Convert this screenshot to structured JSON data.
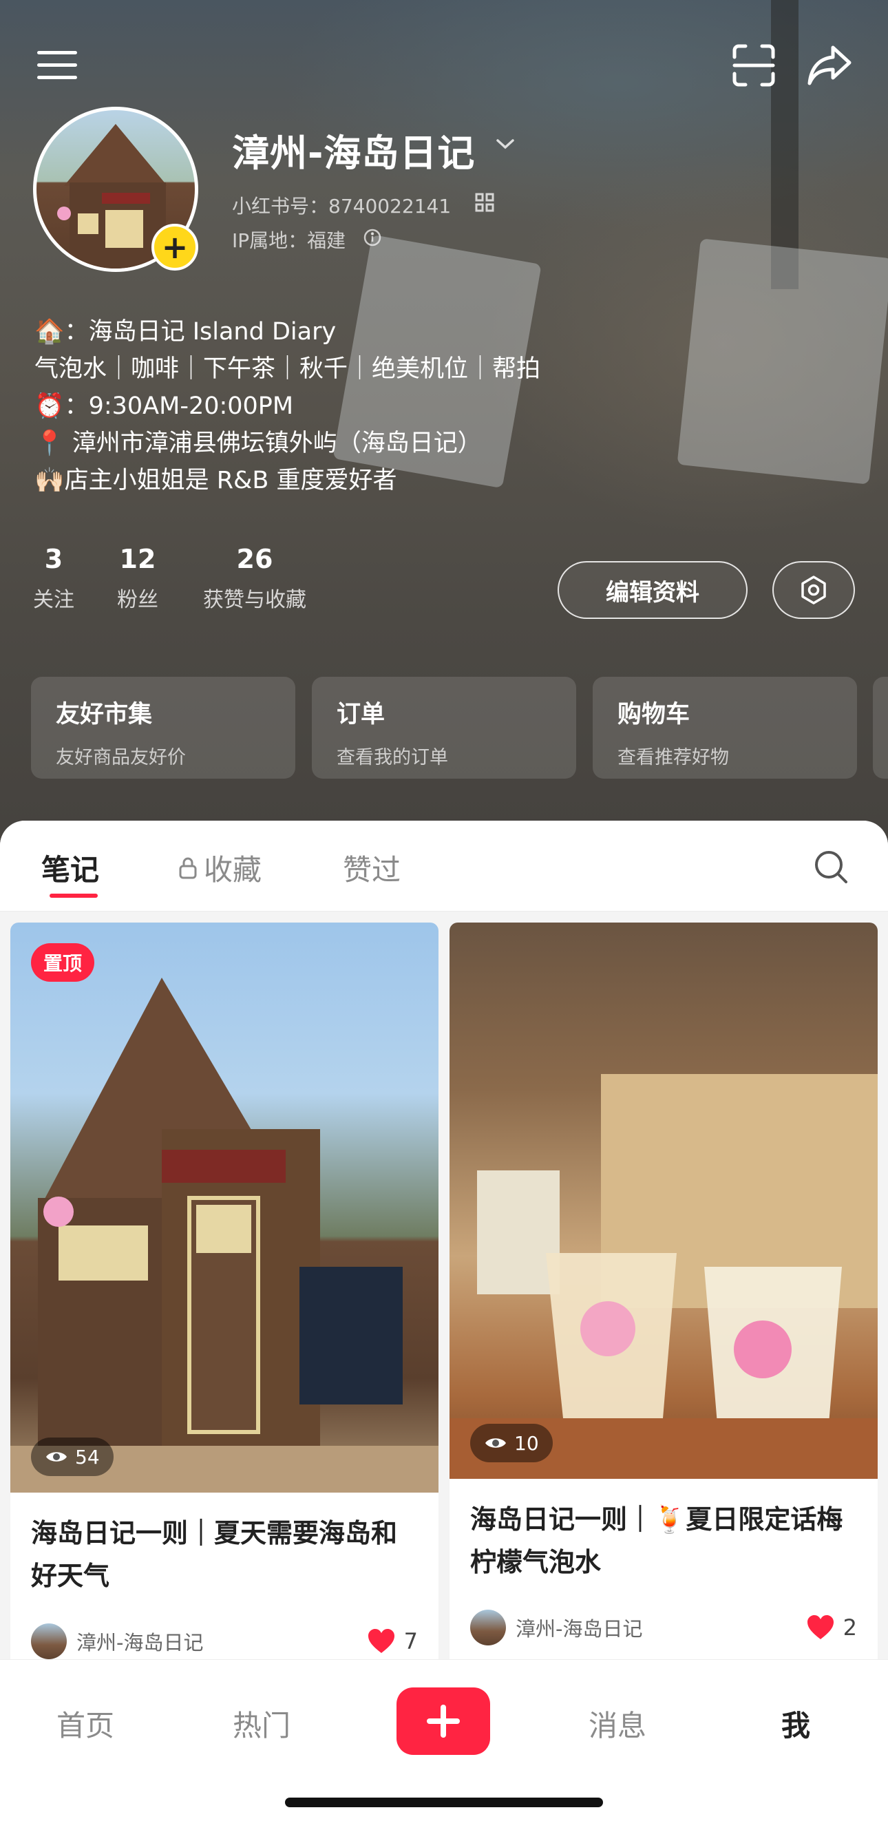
{
  "header": {
    "name": "漳州-海岛日记",
    "xhs_id": "小红书号：8740022141",
    "ip_location": "IP属地：福建"
  },
  "bio": [
    "🏠：海岛日记 Island Diary",
    "气泡水｜咖啡｜下午茶｜秋千｜绝美机位｜帮拍",
    "⏰：9:30AM-20:00PM",
    "📍 漳州市漳浦县佛坛镇外屿（海岛日记）",
    "🙌🏻店主小姐姐是 R&B 重度爱好者"
  ],
  "stats": {
    "following": {
      "value": "3",
      "label": "关注"
    },
    "followers": {
      "value": "12",
      "label": "粉丝"
    },
    "likes": {
      "value": "26",
      "label": "获赞与收藏"
    }
  },
  "buttons": {
    "edit_profile": "编辑资料"
  },
  "service_cards": [
    {
      "title": "友好市集",
      "subtitle": "友好商品友好价"
    },
    {
      "title": "订单",
      "subtitle": "查看我的订单"
    },
    {
      "title": "购物车",
      "subtitle": "查看推荐好物"
    }
  ],
  "tabs": [
    {
      "label": "笔记"
    },
    {
      "label": "收藏"
    },
    {
      "label": "赞过"
    }
  ],
  "notes": [
    {
      "badge": "置顶",
      "views": "54",
      "title": "海岛日记一则｜夏天需要海岛和好天气",
      "author": "漳州-海岛日记",
      "likes": "7"
    },
    {
      "views": "10",
      "title": "海岛日记一则｜🍹夏日限定话梅柠檬气泡水",
      "author": "漳州-海岛日记",
      "likes": "2"
    }
  ],
  "bottom_nav": {
    "home": "首页",
    "hot": "热门",
    "messages": "消息",
    "me": "我"
  },
  "colors": {
    "accent": "#ff2442",
    "add_badge": "#ffd71a"
  },
  "icons": [
    "menu-icon",
    "scan-icon",
    "share-icon",
    "chevron-down-icon",
    "qr-code-icon",
    "info-icon",
    "settings-icon",
    "lock-icon",
    "search-icon",
    "eye-icon",
    "heart-icon",
    "plus-icon"
  ]
}
